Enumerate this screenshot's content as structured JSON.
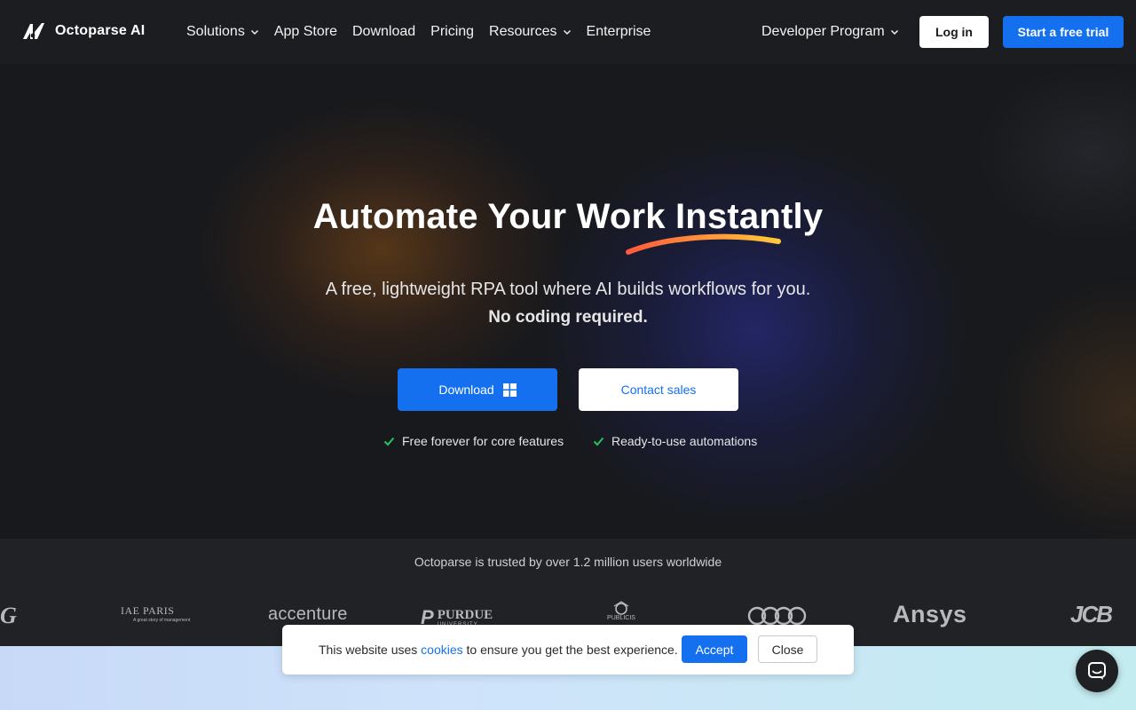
{
  "brand": {
    "name": "Octoparse AI"
  },
  "nav": {
    "items": [
      {
        "label": "Solutions",
        "dropdown": true
      },
      {
        "label": "App Store",
        "dropdown": false
      },
      {
        "label": "Download",
        "dropdown": false
      },
      {
        "label": "Pricing",
        "dropdown": false
      },
      {
        "label": "Resources",
        "dropdown": true
      },
      {
        "label": "Enterprise",
        "dropdown": false
      }
    ],
    "developer_label": "Developer Program",
    "login_label": "Log in",
    "trial_label": "Start a free trial"
  },
  "hero": {
    "headline": "Automate Your Work Instantly",
    "subtitle_line1": "A free, lightweight RPA tool where AI builds workflows for you.",
    "subtitle_line2": "No coding required.",
    "download_label": "Download",
    "contact_label": "Contact sales",
    "features": [
      "Free forever for core features",
      "Ready-to-use automations"
    ]
  },
  "trust": {
    "text": "Octoparse is trusted by over 1.2 million users worldwide",
    "logos": {
      "g": "G",
      "iae": "IAE PARIS",
      "iae_tag": "A great story of management",
      "accenture": "accenture",
      "purdue": "PURDUE",
      "purdue_sub": "UNIVERSITY",
      "publicis": "PUBLICIS",
      "ansys": "Ansys",
      "jcb": "JCB"
    }
  },
  "cookie": {
    "text_before": "This website uses ",
    "link": "cookies",
    "text_after": " to ensure you get the best experience.",
    "accept_label": "Accept",
    "close_label": "Close"
  },
  "colors": {
    "accent": "#1570ef",
    "nav_bg": "#1c1d20",
    "hero_bg": "#18191c",
    "check": "#22c55e"
  },
  "icons": {
    "brand": "octoparse-logo-icon",
    "windows": "windows-icon",
    "check": "check-icon",
    "chat": "chat-icon"
  }
}
